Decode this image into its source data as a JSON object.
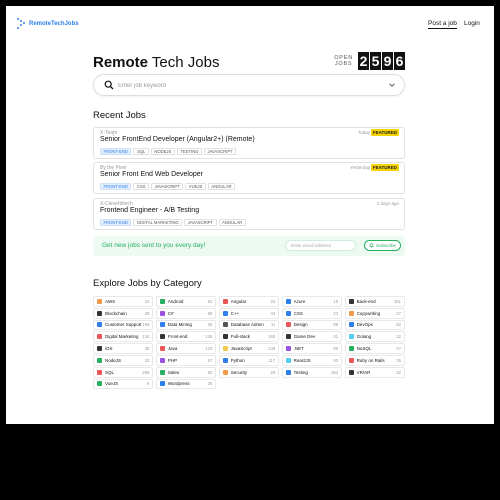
{
  "nav": {
    "logo": "RemoteTechJobs",
    "post_job": "Post a job",
    "login": "Login"
  },
  "header": {
    "title_bold": "Remote",
    "title_rest": " Tech Jobs",
    "counter_label_1": "OPEN",
    "counter_label_2": "JOBS",
    "digits": [
      "2",
      "5",
      "9",
      "6"
    ]
  },
  "search": {
    "placeholder": "Enter job keyword",
    "value": ""
  },
  "recent": {
    "heading": "Recent Jobs",
    "jobs": [
      {
        "company": "X-Team",
        "title": "Senior FrontEnd Developer (Angular2+) (Remote)",
        "date": "Today",
        "badge": "FEATURED",
        "tags": [
          "FRONT-END",
          "SQL",
          "NODEJS",
          "TESTING",
          "JAVASCRIPT"
        ]
      },
      {
        "company": "By the Pixel",
        "title": "Senior Front End Web Developer",
        "date": "Yesterday",
        "badge": "FEATURED",
        "tags": [
          "FRONT-END",
          "CSS",
          "JAVASCRIPT",
          "VUEJS",
          "ANGULAR"
        ]
      },
      {
        "company": "X-Cleverbitech",
        "title": "Frontend Engineer - A/B Testing",
        "date": "2 days ago",
        "badge": "",
        "tags": [
          "FRONT-END",
          "DIGITAL MARKETING",
          "JAVASCRIPT",
          "ANGULAR"
        ]
      }
    ]
  },
  "subscribe": {
    "text": "Get new jobs sent to you every day!",
    "placeholder": "Enter email address",
    "button": "Subscribe"
  },
  "explore": {
    "heading": "Explore Jobs by Category",
    "categories": [
      {
        "name": "AWS",
        "count": "24",
        "color": "#f2994a"
      },
      {
        "name": "Android",
        "count": "62",
        "color": "#27ae60"
      },
      {
        "name": "Angular",
        "count": "22",
        "color": "#eb5757"
      },
      {
        "name": "Azure",
        "count": "18",
        "color": "#2f80ed"
      },
      {
        "name": "Back-end",
        "count": "151",
        "color": "#333333"
      },
      {
        "name": "Blockchain",
        "count": "29",
        "color": "#333333"
      },
      {
        "name": "C#",
        "count": "66",
        "color": "#9b51e0"
      },
      {
        "name": "C++",
        "count": "43",
        "color": "#2f80ed"
      },
      {
        "name": "CSS",
        "count": "23",
        "color": "#2f80ed"
      },
      {
        "name": "Copywriting",
        "count": "37",
        "color": "#f2994a"
      },
      {
        "name": "Customer Support",
        "count": "194",
        "color": "#2f80ed"
      },
      {
        "name": "Data Mining",
        "count": "28",
        "color": "#2f80ed"
      },
      {
        "name": "Database Admin",
        "count": "11",
        "color": "#555555"
      },
      {
        "name": "Design",
        "count": "88",
        "color": "#eb5757"
      },
      {
        "name": "DevOps",
        "count": "82",
        "color": "#2f80ed"
      },
      {
        "name": "Digital Marketing",
        "count": "134",
        "color": "#eb5757"
      },
      {
        "name": "Front-end",
        "count": "136",
        "color": "#333333"
      },
      {
        "name": "Full-stack",
        "count": "160",
        "color": "#333333"
      },
      {
        "name": "Game Dev",
        "count": "31",
        "color": "#333333"
      },
      {
        "name": "Golang",
        "count": "32",
        "color": "#56ccf2"
      },
      {
        "name": "iOS",
        "count": "35",
        "color": "#333333"
      },
      {
        "name": "Java",
        "count": "123",
        "color": "#eb5757"
      },
      {
        "name": "JavaScript",
        "count": "136",
        "color": "#f2c94c"
      },
      {
        "name": ".NET",
        "count": "80",
        "color": "#9b51e0"
      },
      {
        "name": "NoSQL",
        "count": "27",
        "color": "#27ae60"
      },
      {
        "name": "NodeJS",
        "count": "23",
        "color": "#27ae60"
      },
      {
        "name": "PHP",
        "count": "57",
        "color": "#9b51e0"
      },
      {
        "name": "Python",
        "count": "117",
        "color": "#2f80ed"
      },
      {
        "name": "ReactJS",
        "count": "93",
        "color": "#56ccf2"
      },
      {
        "name": "Ruby on Rails",
        "count": "35",
        "color": "#eb5757"
      },
      {
        "name": "SQL",
        "count": "259",
        "color": "#eb5757"
      },
      {
        "name": "Sales",
        "count": "82",
        "color": "#27ae60"
      },
      {
        "name": "Security",
        "count": "28",
        "color": "#f2994a"
      },
      {
        "name": "Testing",
        "count": "164",
        "color": "#2f80ed"
      },
      {
        "name": "VR/AR",
        "count": "32",
        "color": "#333333"
      },
      {
        "name": "VueJS",
        "count": "9",
        "color": "#27ae60"
      },
      {
        "name": "Wordpress",
        "count": "25",
        "color": "#2f80ed"
      }
    ]
  }
}
